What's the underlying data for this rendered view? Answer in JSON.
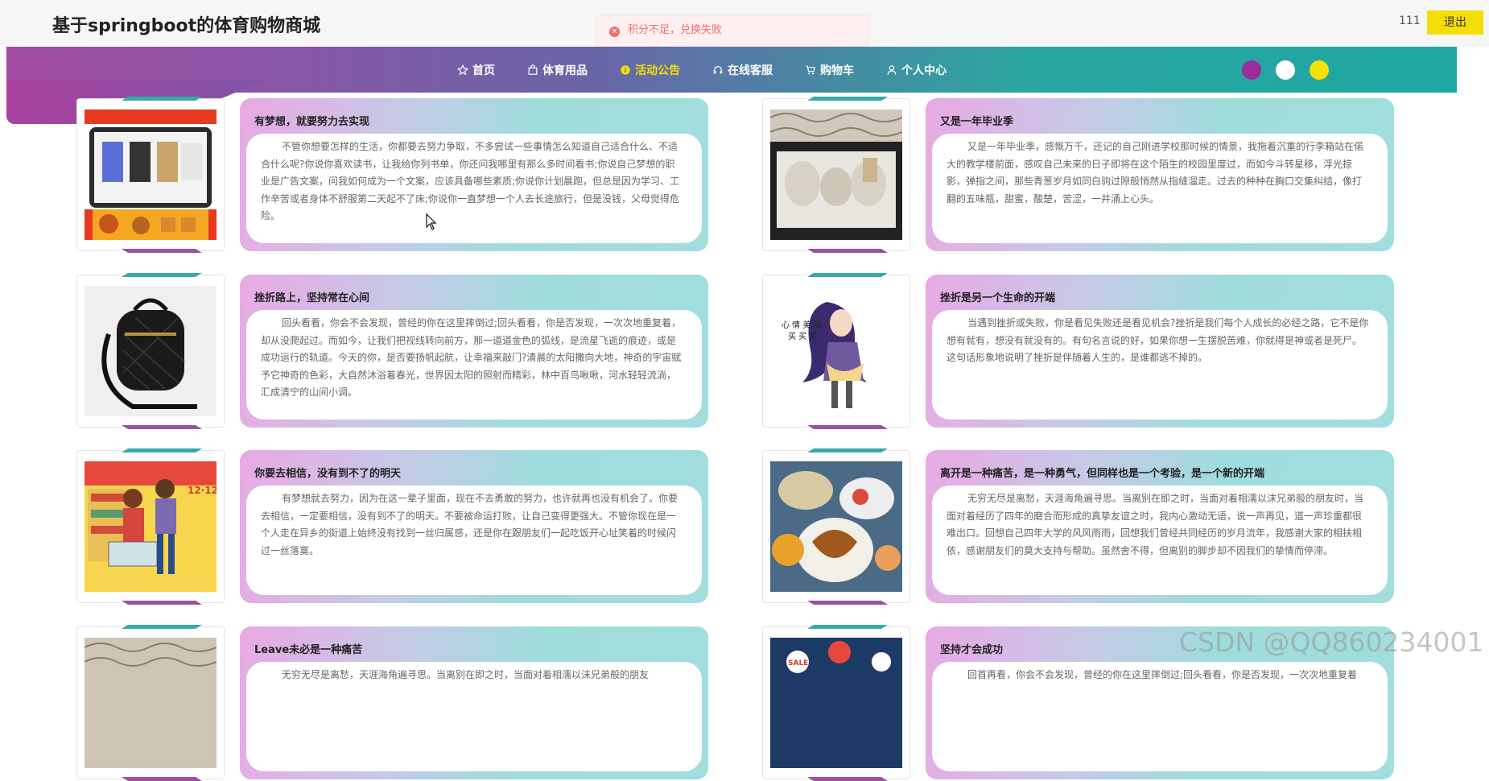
{
  "header": {
    "site_title": "基于springboot的体育购物商城",
    "user_name": "111",
    "logout_label": "退出"
  },
  "toast": {
    "message": "积分不足，兑换失败",
    "type": "error",
    "icon": "close-circle-icon"
  },
  "nav": {
    "items": [
      {
        "label": "首页",
        "icon": "star-icon"
      },
      {
        "label": "体育用品",
        "icon": "bag-icon"
      },
      {
        "label": "活动公告",
        "icon": "info-circle-icon",
        "active": true
      },
      {
        "label": "在线客服",
        "icon": "headset-icon"
      },
      {
        "label": "购物车",
        "icon": "cart-icon"
      },
      {
        "label": "个人中心",
        "icon": "user-icon"
      }
    ],
    "theme_colors": [
      "#9b2c9e",
      "#ffffff",
      "#f5e20a"
    ],
    "accent": "#f5dd0a"
  },
  "announcements": [
    {
      "title": "有梦想，就要努力去实现",
      "body": "不管你想要怎样的生活，你都要去努力争取，不多尝试一些事情怎么知道自己适合什么、不适合什么呢?你说你喜欢读书，让我给你列书单，你还问我哪里有那么多时间看书;你说自己梦想的职业是广告文案，问我如何成为一个文案，应该具备哪些素质;你说你计划晨跑，但总是因为学习、工作辛苦或者身体不舒服第二天起不了床;你说你一直梦想一个人去长途旅行，但是没钱，父母觉得危险。",
      "image": "phone-shop-image"
    },
    {
      "title": "又是一年毕业季",
      "body": "又是一年毕业季，感慨万千，还记的自己刚进学校那时候的情景，我拖着沉重的行李箱站在偌大的教学楼前面，感叹自己未来的日子即将在这个陌生的校园里度过，而如今斗转星移，浮光掠影，弹指之间，那些青葱岁月如同白驹过隙般悄然从指缝溜走。过去的种种在胸口交集纠结，像打翻的五味瓶，甜蜜，酸楚，苦涩，一并涌上心头。",
      "image": "gift-box-image"
    },
    {
      "title": "挫折路上，坚持常在心间",
      "body": "回头看看，你会不会发现，曾经的你在这里摔倒过;回头看看，你是否发现，一次次地重复着，却从没爬起过。而如今，让我们把视线转向前方，那一道道金色的弧线，是流星飞逝的痕迹，或是成功运行的轨道。今天的你，是否要扬帆起航，让幸福来敲门?清晨的太阳撒向大地，神奇的宇宙赋予它神奇的色彩，大自然沐浴着春光，世界因太阳的照射而精彩，林中百鸟啾啾，河水轻轻流淌，汇成清宁的山间小调。",
      "image": "backpack-image"
    },
    {
      "title": "挫折是另一个生命的开端",
      "body": "当遇到挫折或失败，你是看见失败还是看见机会?挫折是我们每个人成长的必经之路，它不是你想有就有，想没有就没有的。有句名言说的好，如果你想一生摆脱苦难，你就得是神或者是死尸。这句话形象地说明了挫折是伴随着人生的，是谁都逃不掉的。",
      "image": "cartoon-girl-image",
      "image_caption": "心 情 美 丽\n买 买 买"
    },
    {
      "title": "你要去相信，没有到不了的明天",
      "body": "有梦想就去努力，因为在这一辈子里面，现在不去勇敢的努力，也许就再也没有机会了。你要去相信，一定要相信，没有到不了的明天。不要被命运打败，让自己变得更强大。不管你现在是一个人走在异乡的街道上始终没有找到一丝归属感，还是你在跟朋友们一起吃饭开心址笑着的时候闪过一丝落寞。",
      "image": "shopping-couple-image",
      "image_caption": "12·12"
    },
    {
      "title": "离开是一种痛苦，是一种勇气，但同样也是一个考验，是一个新的开端",
      "body": "无穷无尽是离愁，天涯海角遍寻思。当离别在即之时，当面对着相濡以沫兄弟般的朋友时，当面对着经历了四年的磨合而形成的真挚友谊之时，我内心激动无语，说一声再见，道一声珍重都很难出口。回想自己四年大学的风风雨雨，回想我们曾经共同经历的岁月流年，我感谢大家的相扶相依，感谢朋友们的莫大支持与帮助。虽然舍不得，但离别的脚步却不因我们的挚情而停滞。",
      "image": "food-table-image"
    },
    {
      "title": "Leave未必是一种痛苦",
      "body": "无穷无尽是离愁，天涯海角遍寻思。当离别在即之时，当面对着相濡以沫兄弟般的朋友",
      "image": "pattern-box-image"
    },
    {
      "title": "坚持才会成功",
      "body": "回首再看，你会不会发现，曾经的你在这里摔倒过;回头看看，你是否发现，一次次地重复着",
      "image": "sale-icons-image",
      "image_caption": "SALE"
    }
  ],
  "watermark": "CSDN @QQ860234001"
}
